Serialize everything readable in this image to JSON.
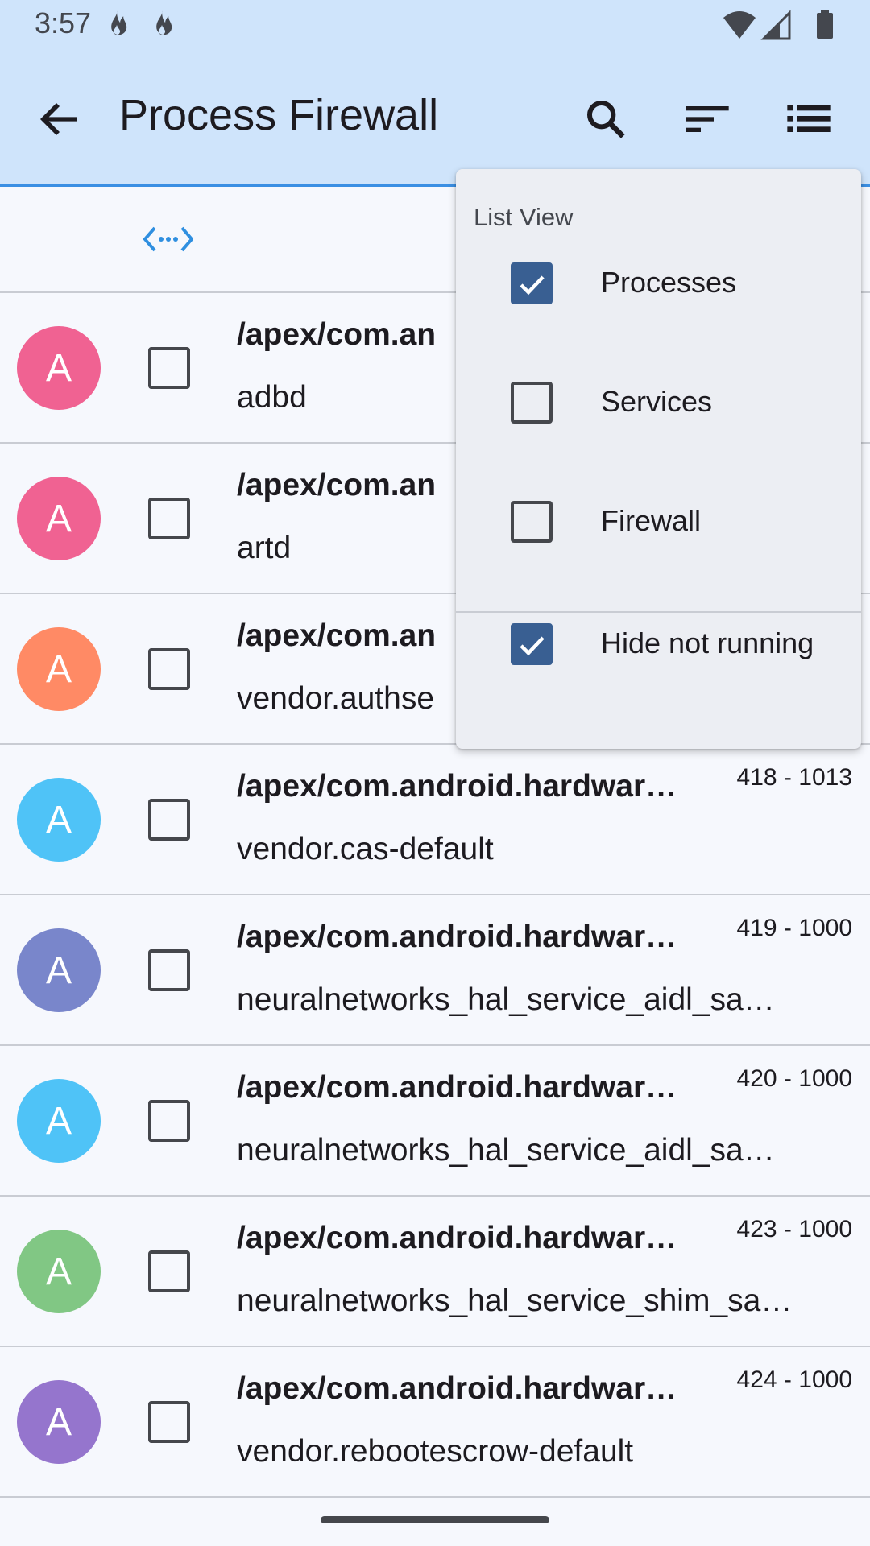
{
  "status_bar": {
    "time": "3:57",
    "icons": [
      "flame-icon",
      "flame-icon",
      "wifi-icon",
      "signal-icon",
      "battery-icon"
    ]
  },
  "app_bar": {
    "title": "Process Firewall",
    "actions": [
      "search-icon",
      "sort-icon",
      "list-view-icon"
    ]
  },
  "subheader": {
    "icon": "code-arrows-icon"
  },
  "menu": {
    "header": "List View",
    "items": [
      {
        "label": "Processes",
        "checked": true
      },
      {
        "label": "Services",
        "checked": false
      },
      {
        "label": "Firewall",
        "checked": false
      },
      {
        "label": "Hide not running",
        "checked": true
      }
    ]
  },
  "rows": [
    {
      "avatar": "A",
      "color": "#f06292",
      "title": "/apex/com.an",
      "subtitle": "adbd",
      "pid": ""
    },
    {
      "avatar": "A",
      "color": "#f06292",
      "title": "/apex/com.an",
      "subtitle": "artd",
      "pid": ""
    },
    {
      "avatar": "A",
      "color": "#ff8a65",
      "title": "/apex/com.an",
      "subtitle": "vendor.authse",
      "pid": ""
    },
    {
      "avatar": "A",
      "color": "#4fc3f7",
      "title": "/apex/com.android.hardwar…",
      "subtitle": "vendor.cas-default",
      "pid": "418 - 1013"
    },
    {
      "avatar": "A",
      "color": "#7986cb",
      "title": "/apex/com.android.hardwar…",
      "subtitle": "neuralnetworks_hal_service_aidl_sa…",
      "pid": "419 - 1000"
    },
    {
      "avatar": "A",
      "color": "#4fc3f7",
      "title": "/apex/com.android.hardwar…",
      "subtitle": "neuralnetworks_hal_service_aidl_sa…",
      "pid": "420 - 1000"
    },
    {
      "avatar": "A",
      "color": "#81c784",
      "title": "/apex/com.android.hardwar…",
      "subtitle": "neuralnetworks_hal_service_shim_sa…",
      "pid": "423 - 1000"
    },
    {
      "avatar": "A",
      "color": "#9575cd",
      "title": "/apex/com.android.hardwar…",
      "subtitle": "vendor.rebootescrow-default",
      "pid": "424 - 1000"
    }
  ]
}
